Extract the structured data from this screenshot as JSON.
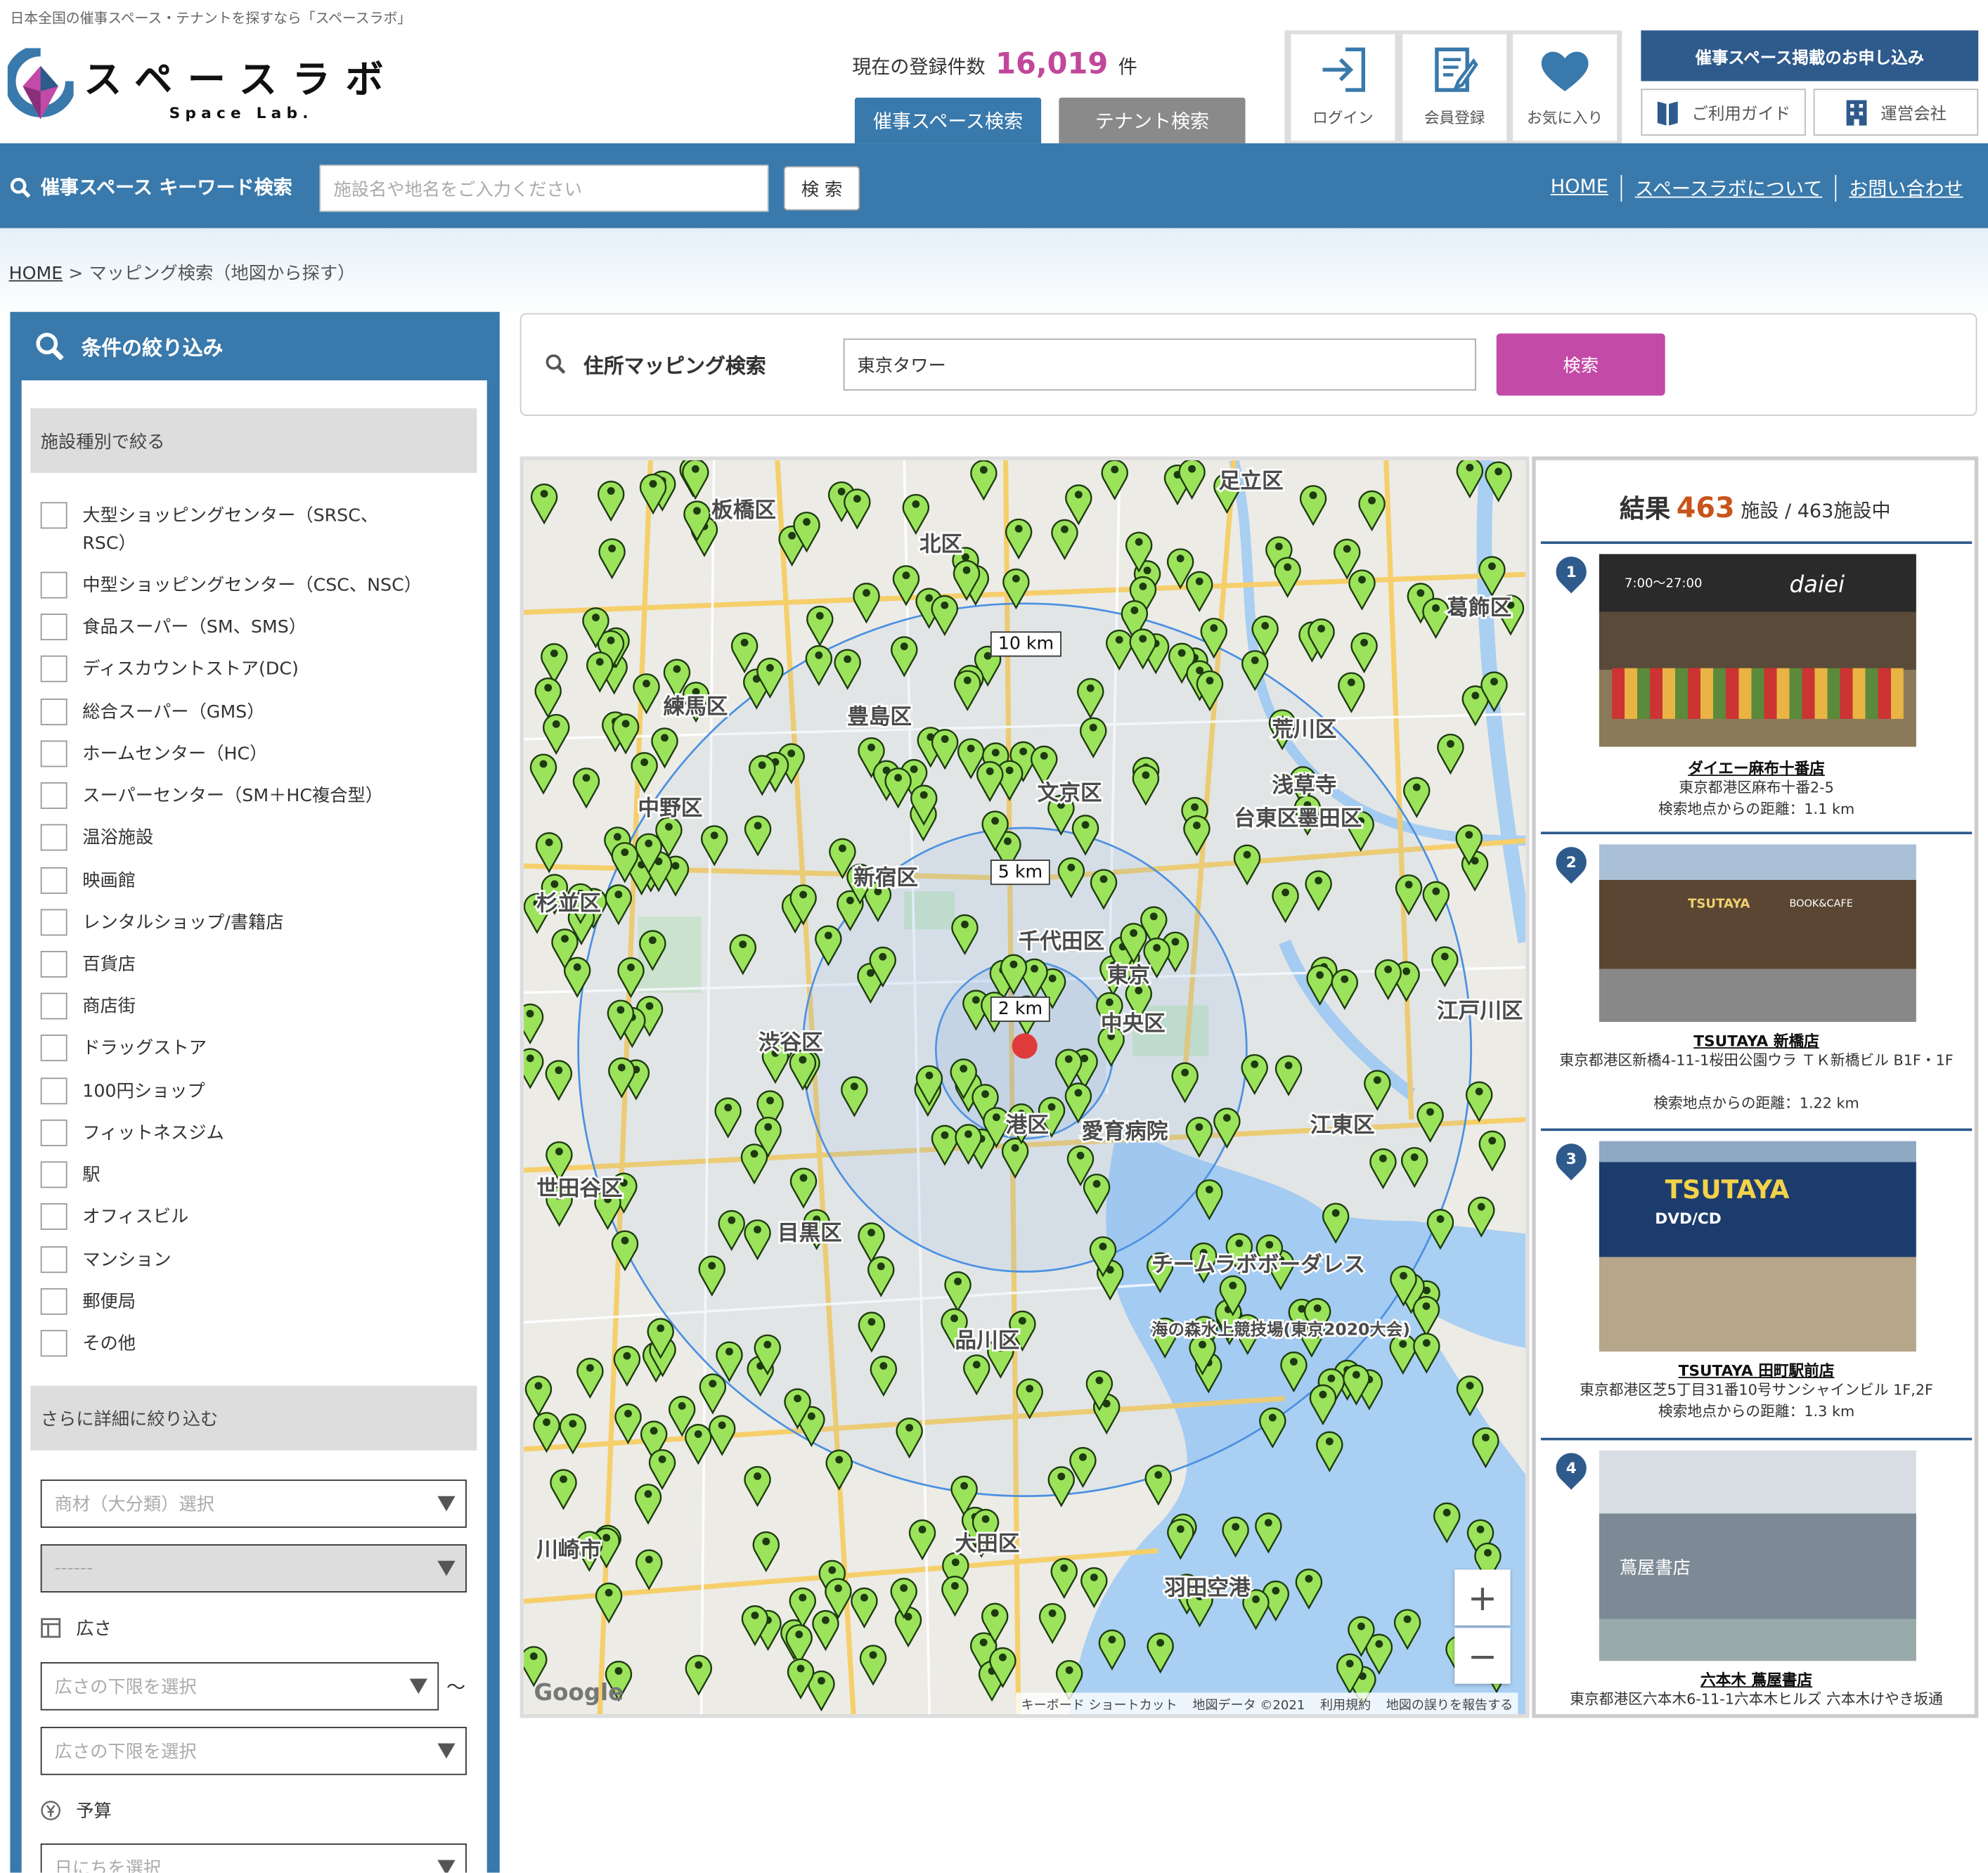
{
  "header": {
    "tagline": "日本全国の催事スペース・テナントを探すなら「スペースラボ」",
    "logo_jp": "スペースラボ",
    "logo_en": "Space Lab.",
    "reg_label": "現在の登録件数",
    "reg_count": "16,019",
    "reg_unit": "件",
    "tab_event": "催事スペース検索",
    "tab_tenant": "テナント検索",
    "login": "ログイン",
    "signup": "会員登録",
    "favorites": "お気に入り",
    "apply": "催事スペース掲載のお申し込み",
    "guide": "ご利用ガイド",
    "company": "運営会社"
  },
  "keyword_bar": {
    "title": "催事スペース キーワード検索",
    "placeholder": "施設名や地名をご入力ください",
    "button": "検 索",
    "links": [
      "HOME",
      "スペースラボについて",
      "お問い合わせ"
    ]
  },
  "breadcrumb": {
    "home": "HOME",
    "current": "> マッピング検索（地図から探す）"
  },
  "sidebar": {
    "title": "条件の絞り込み",
    "facility_header": "施設種別で絞る",
    "facility_types": [
      "大型ショッピングセンター（SRSC、",
      "中型ショッピングセンター（CSC、NSC）",
      "食品スーパー（SM、SMS）",
      "ディスカウントストア(DC)",
      "総合スーパー（GMS）",
      "ホームセンター（HC）",
      "スーパーセンター（SM＋HC複合型）",
      "温浴施設",
      "映画館",
      "レンタルショップ/書籍店",
      "百貨店",
      "商店街",
      "ドラッグストア",
      "100円ショップ",
      "フィットネスジム",
      "駅",
      "オフィスビル",
      "マンション",
      "郵便局",
      "その他"
    ],
    "facility_type0_line2": "RSC）",
    "detail_header": "さらに詳細に絞り込む",
    "product_select": "商材（大分類）選択",
    "sub_select": "------",
    "area_label": "広さ",
    "area_min": "広さの下限を選択",
    "tilde": "〜",
    "area_max": "広さの下限を選択",
    "budget_label": "予算",
    "date_select": "日にちを選択"
  },
  "mapping": {
    "title": "住所マッピング検索",
    "query": "東京タワー",
    "button": "検索"
  },
  "map": {
    "rings": [
      "10 km",
      "5 km",
      "2 km"
    ],
    "attribution": [
      "キーボード ショートカット",
      "地図データ ©2021",
      "利用規約",
      "地図の誤りを報告する"
    ],
    "google": "Google",
    "labels": [
      {
        "t": "板橋区"
      },
      {
        "t": "北区"
      },
      {
        "t": "足立区"
      },
      {
        "t": "葛飾区"
      },
      {
        "t": "豊島区"
      },
      {
        "t": "文京区"
      },
      {
        "t": "荒川区"
      },
      {
        "t": "墨田区"
      },
      {
        "t": "台東区"
      },
      {
        "t": "練馬区"
      },
      {
        "t": "中野区"
      },
      {
        "t": "新宿区"
      },
      {
        "t": "千代田区"
      },
      {
        "t": "中央区"
      },
      {
        "t": "渋谷区"
      },
      {
        "t": "港区"
      },
      {
        "t": "江東区"
      },
      {
        "t": "世田谷区"
      },
      {
        "t": "目黒区"
      },
      {
        "t": "品川区"
      },
      {
        "t": "大田区"
      },
      {
        "t": "川崎市"
      },
      {
        "t": "杉並区"
      },
      {
        "t": "江戸川区"
      },
      {
        "t": "東京"
      },
      {
        "t": "羽田空港"
      },
      {
        "t": "浅草寺"
      },
      {
        "t": "愛育病院"
      },
      {
        "t": "チームラボボーダレス"
      },
      {
        "t": "海の森水上競技場(東京2020大会)"
      }
    ]
  },
  "results": {
    "label": "結果",
    "count": "463",
    "unit": "施設",
    "total": "/ 463施設中",
    "items": [
      {
        "num": "1",
        "name": "ダイエー麻布十番店",
        "addr": "東京都港区麻布十番2-5",
        "dist": "検索地点からの距離：1.1 km",
        "photo_text": "daiei",
        "photo_sub": "7:00〜27:00"
      },
      {
        "num": "2",
        "name": "TSUTAYA 新橋店",
        "addr": "東京都港区新橋4-11-1桜田公園ウラ ＴＫ新橋ビル B1F・1F",
        "dist": "検索地点からの距離：1.22 km",
        "photo_text": "TSUTAYA",
        "photo_sub": "BOOK&CAFE"
      },
      {
        "num": "3",
        "name": "TSUTAYA 田町駅前店",
        "addr": "東京都港区芝5丁目31番10号サンシャインビル 1F,2F",
        "dist": "検索地点からの距離：1.3 km",
        "photo_text": "TSUTAYA",
        "photo_sub": "DVD/CD"
      },
      {
        "num": "4",
        "name": "六本木 蔦屋書店",
        "addr": "東京都港区六本木6-11-1六本木ヒルズ 六本木けやき坂通",
        "dist": "",
        "photo_text": "蔦屋書店",
        "photo_sub": ""
      }
    ]
  },
  "colors": {
    "brand_blue": "#3979ab",
    "navy": "#2e5a8c",
    "magenta": "#c34aa6",
    "pin_green": "#9be35a",
    "count_orange": "#c9541a"
  }
}
